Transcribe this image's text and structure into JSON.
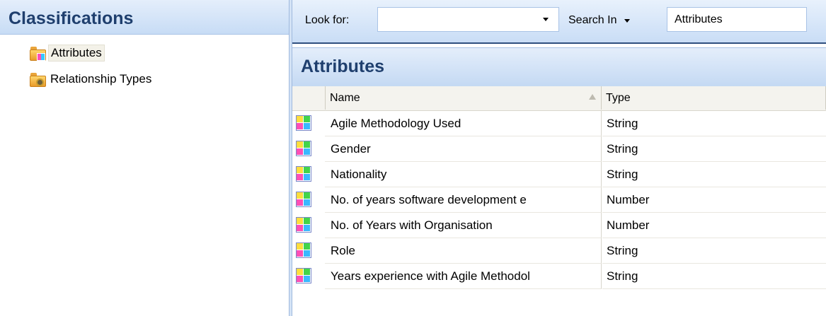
{
  "classifications": {
    "title": "Classifications",
    "items": [
      {
        "label": "Attributes",
        "icon": "attributes-folder-icon",
        "selected": true
      },
      {
        "label": "Relationship Types",
        "icon": "relationship-types-folder-icon",
        "selected": false
      }
    ]
  },
  "toolbar": {
    "look_for_label": "Look for:",
    "look_for_value": "",
    "search_in_label": "Search In",
    "search_in_value": "Attributes"
  },
  "attributes_panel": {
    "title": "Attributes",
    "columns": [
      "Name",
      "Type"
    ],
    "rows": [
      {
        "name": "Agile Methodology Used",
        "type": "String"
      },
      {
        "name": "Gender",
        "type": "String"
      },
      {
        "name": "Nationality",
        "type": "String"
      },
      {
        "name": "No. of years software development e",
        "type": "Number"
      },
      {
        "name": "No. of Years with Organisation",
        "type": "Number"
      },
      {
        "name": "Role",
        "type": "String"
      },
      {
        "name": "Years experience with Agile Methodol",
        "type": "String"
      }
    ]
  },
  "colors": {
    "header_text": "#1f3f6e",
    "header_gradient_top": "#e4eefb",
    "header_gradient_bottom": "#c4d9f3"
  }
}
